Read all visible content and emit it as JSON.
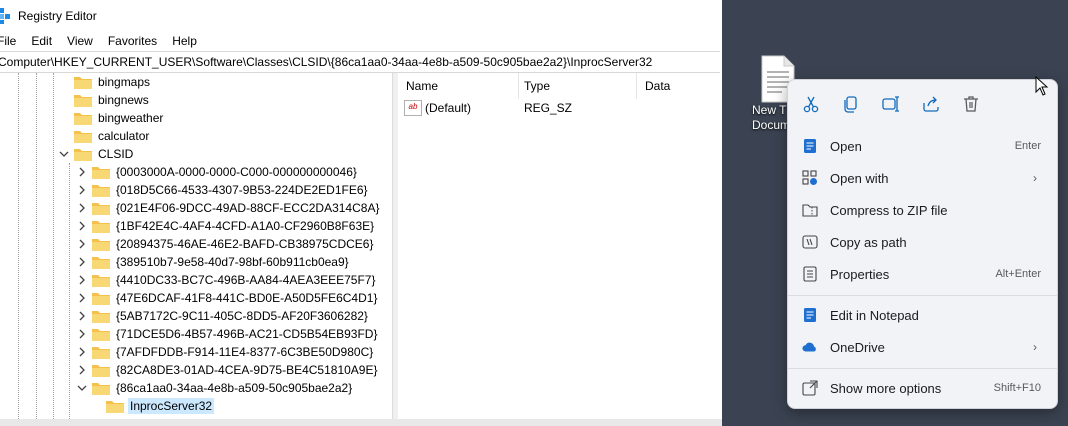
{
  "window": {
    "title": "Registry Editor"
  },
  "menu": [
    "File",
    "Edit",
    "View",
    "Favorites",
    "Help"
  ],
  "address": "Computer\\HKEY_CURRENT_USER\\Software\\Classes\\CLSID\\{86ca1aa0-34aa-4e8b-a509-50c905bae2a2}\\InprocServer32",
  "tree": {
    "items": [
      "bingmaps",
      "bingnews",
      "bingweather",
      "calculator",
      "CLSID",
      "{0003000A-0000-0000-C000-000000000046}",
      "{018D5C66-4533-4307-9B53-224DE2ED1FE6}",
      "{021E4F06-9DCC-49AD-88CF-ECC2DA314C8A}",
      "{1BF42E4C-4AF4-4CFD-A1A0-CF2960B8F63E}",
      "{20894375-46AE-46E2-BAFD-CB38975CDCE6}",
      "{389510b7-9e58-40d7-98bf-60b911cb0ea9}",
      "{4410DC33-BC7C-496B-AA84-4AEA3EEE75F7}",
      "{47E6DCAF-41F8-441C-BD0E-A50D5FE6C4D1}",
      "{5AB7172C-9C11-405C-8DD5-AF20F3606282}",
      "{71DCE5D6-4B57-496B-AC21-CD5B54EB93FD}",
      "{7AFDFDDB-F914-11E4-8377-6C3BE50D980C}",
      "{82CA8DE3-01AD-4CEA-9D75-BE4C51810A9E}",
      "{86ca1aa0-34aa-4e8b-a509-50c905bae2a2}",
      "InprocServer32"
    ]
  },
  "values": {
    "columns": [
      "Name",
      "Type",
      "Data"
    ],
    "rows": [
      {
        "name": "(Default)",
        "type": "REG_SZ",
        "data": ""
      }
    ]
  },
  "desktop": {
    "icon_label_line1": "New T",
    "icon_label_line2": "Docum"
  },
  "context_menu": {
    "quick_actions": [
      "cut-icon",
      "copy-icon",
      "rename-icon",
      "share-icon",
      "delete-icon"
    ],
    "items": [
      {
        "label": "Open",
        "accel": "Enter",
        "icon": "notepad-icon"
      },
      {
        "label": "Open with",
        "accel": "",
        "icon": "open-with-icon"
      },
      {
        "label": "Compress to ZIP file",
        "accel": "",
        "icon": "zip-icon"
      },
      {
        "label": "Copy as path",
        "accel": "",
        "icon": "copy-path-icon"
      },
      {
        "label": "Properties",
        "accel": "Alt+Enter",
        "icon": "properties-icon"
      },
      {
        "label": "Edit in Notepad",
        "accel": "",
        "icon": "notepad-icon"
      },
      {
        "label": "OneDrive",
        "accel": "",
        "icon": "onedrive-icon"
      },
      {
        "label": "Show more options",
        "accel": "Shift+F10",
        "icon": "more-options-icon"
      }
    ]
  },
  "colors": {
    "accent": "#0f6cbd",
    "folder": "#f3c14c",
    "desktop": "#3b4352"
  }
}
